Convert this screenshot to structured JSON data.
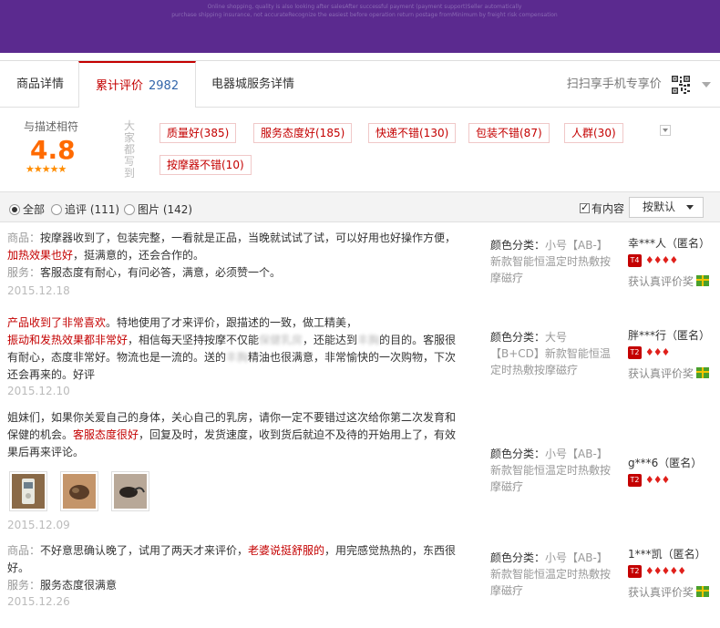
{
  "banner": {
    "line1": "Online shopping, quality is also looking after salesAfter successful payment (payment support)Seller automatically",
    "line2": "purchase shipping insurance, not accurateRecognize the easiest before operation return postage fromMinimum by freight risk compensation"
  },
  "tabs": [
    {
      "label": "商品详情"
    },
    {
      "label": "累计评价",
      "count": "2982"
    },
    {
      "label": "电器城服务详情"
    }
  ],
  "qr": {
    "label": "扫扫享手机专享价"
  },
  "rating": {
    "label": "与描述相符",
    "score": "4.8",
    "stars": "★★★★★",
    "tags_caption": "大家都写到"
  },
  "tags": [
    {
      "label": "质量好(385)"
    },
    {
      "label": "服务态度好(185)"
    },
    {
      "label": "快递不错(130)"
    },
    {
      "label": "包装不错(87)"
    },
    {
      "label": "人群(30)"
    },
    {
      "label": "按摩器不错(10)"
    }
  ],
  "filter": {
    "all": "全部",
    "followup": "追评 (111)",
    "pictures": "图片 (142)",
    "has_content": "有内容",
    "sort": "按默认"
  },
  "reviews": [
    {
      "line1_label": "商品：",
      "line1a": "按摩器收到了，包装完整，一看就是正品，当晚就试试了试，可以好用也好操作方便，",
      "line1b_hl": "加热效果也好",
      "line1c": "，挺满意的，还会合作的。",
      "line2_label": "服务：",
      "line2": "客服态度有耐心，有问必答，满意，必须赞一个。",
      "date": "2015.12.18",
      "sku_key": "颜色分类：",
      "sku_val1": "小号【AB-】",
      "sku_val2": "新款智能恒温定时热敷按",
      "sku_val3": "摩磁疗",
      "user": "幸***人（匿名）",
      "level": "T4",
      "gems": "♦♦♦♦",
      "award": "获认真评价奖"
    },
    {
      "a_hl": "产品收到了非常喜欢",
      "a": "。特地使用了才来评价，跟描述的一致，做工精美，",
      "b_hl": "振动和发热效果都非常好",
      "b": "，相信每天坚持按摩不仅能",
      "b_blur": "保健乳房",
      "b2": "，还能达到",
      "b_blur2": "丰胸",
      "b3": "的目的。客服很",
      "c": "有耐心，态度非常好。物流也是一流的。送的",
      "c_blur": "丰胸",
      "c2": "精油也很满意，非常愉快的一次购物，下次",
      "d": "还会再来的。好评",
      "date": "2015.12.10",
      "sku_key": "颜色分类：",
      "sku_val1": "大号",
      "sku_val2": "【B+CD】新款智能恒温",
      "sku_val3": "定时热敷按摩磁疗",
      "user": "胖***行（匿名）",
      "level": "T2",
      "gems": "♦♦♦",
      "award": "获认真评价奖"
    },
    {
      "a": "姐妹们，如果你关爱自己的身体，关心自己的乳房，请你一定不要错过这次给你第二次发育和",
      "b": "保健的机会。",
      "b_hl": "客服态度很好",
      "b2": "，回复及时，发货速度，收到货后就迫不及待的开始用上了，有效",
      "c": "果后再来评论。",
      "date": "2015.12.09",
      "sku_key": "颜色分类：",
      "sku_val1": "小号【AB-】",
      "sku_val2": "新款智能恒温定时热敷按",
      "sku_val3": "摩磁疗",
      "user": "g***6（匿名）",
      "level": "T2",
      "gems": "♦♦♦"
    },
    {
      "line1_label": "商品：",
      "line1a": "不好意思确认晚了，试用了两天才来评价，",
      "line1b_hl": "老婆说挺舒服的",
      "line1c": "，用完感觉热热的，东西很",
      "line1d": "好。",
      "line2_label": "服务：",
      "line2": "服务态度很满意",
      "date": "2015.12.26",
      "sku_key": "颜色分类：",
      "sku_val1": "小号【AB-】",
      "sku_val2": "新款智能恒温定时热敷按",
      "sku_val3": "摩磁疗",
      "user": "1***凯（匿名）",
      "level": "T2",
      "gems": "♦♦♦♦♦",
      "award": "获认真评价奖"
    }
  ]
}
